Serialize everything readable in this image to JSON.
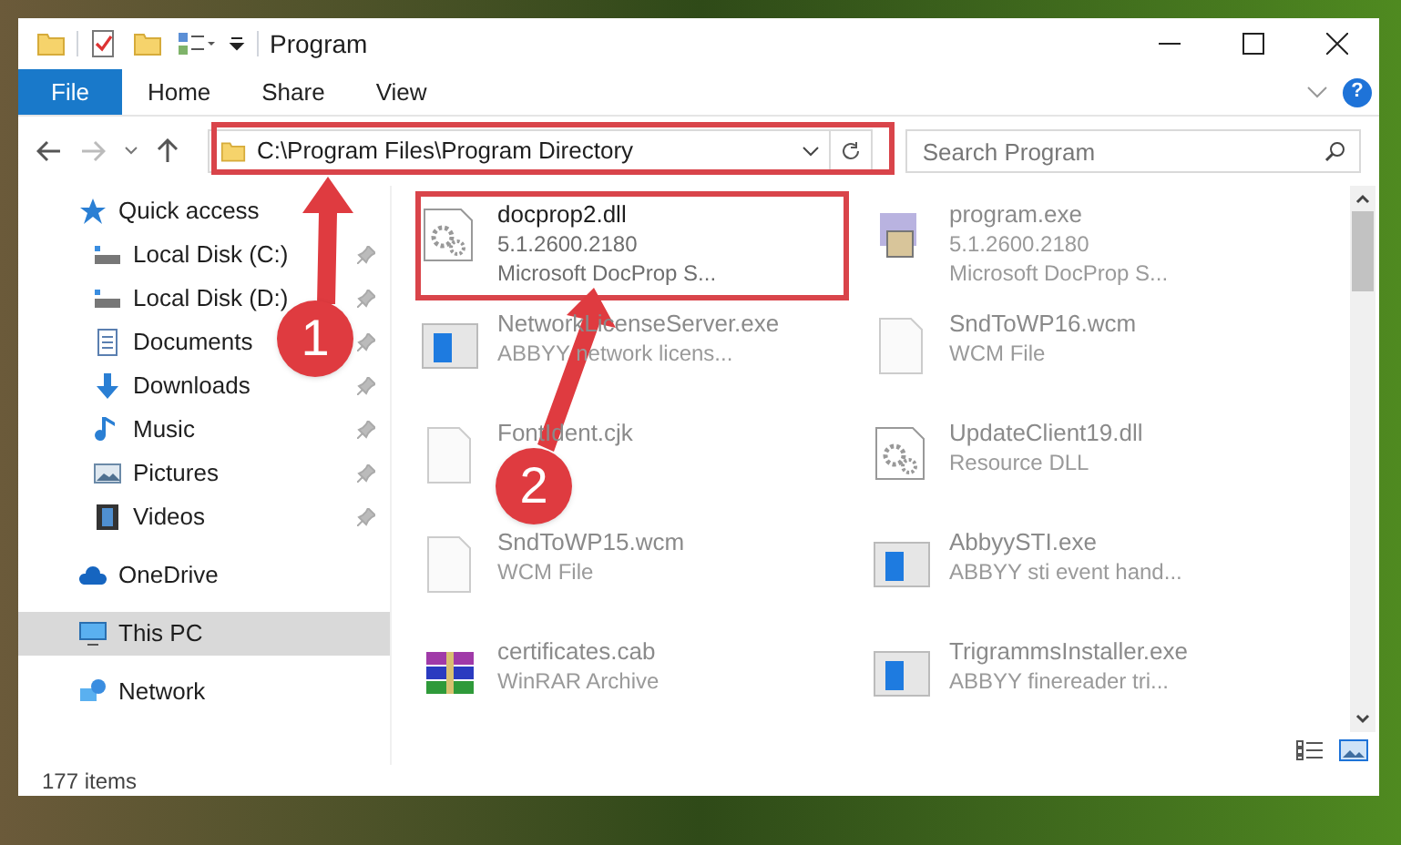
{
  "window": {
    "title": "Program"
  },
  "ribbon_tabs": [
    {
      "label": "File",
      "selected": true
    },
    {
      "label": "Home",
      "selected": false
    },
    {
      "label": "Share",
      "selected": false
    },
    {
      "label": "View",
      "selected": false
    }
  ],
  "help_button": "?",
  "address": {
    "path": "C:\\Program Files\\Program Directory"
  },
  "search": {
    "placeholder": "Search Program"
  },
  "sidebar": {
    "items": [
      {
        "label": "Quick access",
        "selected": false,
        "children": [
          {
            "label": "Local Disk (C:)",
            "pinned": true
          },
          {
            "label": "Local Disk (D:)",
            "pinned": true
          },
          {
            "label": "Documents",
            "pinned": true
          },
          {
            "label": "Downloads",
            "pinned": true
          },
          {
            "label": "Music",
            "pinned": true
          },
          {
            "label": "Pictures",
            "pinned": true
          },
          {
            "label": "Videos",
            "pinned": true
          }
        ]
      },
      {
        "label": "OneDrive",
        "selected": false
      },
      {
        "label": "This PC",
        "selected": true
      },
      {
        "label": "Network",
        "selected": false
      }
    ]
  },
  "files": [
    {
      "name": "docprop2.dll",
      "details": [
        "5.1.2600.2180",
        "Microsoft DocProp S..."
      ],
      "kind": "dll",
      "dimmed": false
    },
    {
      "name": "program.exe",
      "details": [
        "5.1.2600.2180",
        "Microsoft DocProp S..."
      ],
      "kind": "exe",
      "dimmed": true
    },
    {
      "name": "NetworkLicenseServer.exe",
      "details": [
        "ABBYY network licens..."
      ],
      "kind": "app",
      "dimmed": true
    },
    {
      "name": "SndToWP16.wcm",
      "details": [
        "WCM File"
      ],
      "kind": "blank",
      "dimmed": true
    },
    {
      "name": "FontIdent.cjk",
      "kind": "blank",
      "dimmed": true
    },
    {
      "name": "UpdateClient19.dll",
      "details": [
        "Resource DLL"
      ],
      "kind": "dll",
      "dimmed": true
    },
    {
      "name": "SndToWP15.wcm",
      "details": [
        "WCM File"
      ],
      "kind": "blank",
      "dimmed": true
    },
    {
      "name": "AbbyySTI.exe",
      "details": [
        "ABBYY sti event hand..."
      ],
      "kind": "app",
      "dimmed": true
    },
    {
      "name": "certificates.cab",
      "details": [
        "WinRAR Archive"
      ],
      "kind": "cab",
      "dimmed": true
    },
    {
      "name": "TrigrammsInstaller.exe",
      "details": [
        "ABBYY finereader tri..."
      ],
      "kind": "app",
      "dimmed": true
    }
  ],
  "status_bar": {
    "count": "177 items"
  },
  "annotations": [
    {
      "label": "1"
    },
    {
      "label": "2"
    }
  ]
}
